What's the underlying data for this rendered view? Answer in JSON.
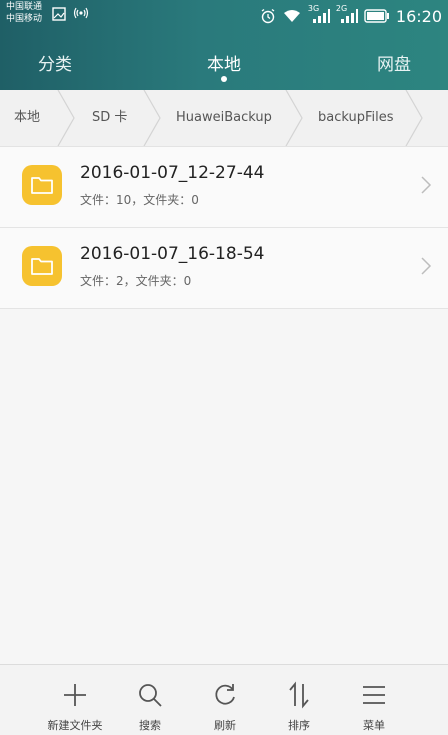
{
  "status_bar": {
    "carrier_1": "中国联通",
    "carrier_2": "中国移动",
    "network_1": "3G",
    "network_2": "2G",
    "time": "16:20"
  },
  "tabs": [
    {
      "label": "分类"
    },
    {
      "label": "本地"
    },
    {
      "label": "网盘"
    }
  ],
  "active_tab": "本地",
  "breadcrumb": [
    "本地",
    "SD 卡",
    "HuaweiBackup",
    "backupFiles"
  ],
  "files": [
    {
      "name": "2016-01-07_12-27-44",
      "meta": "文件：10，文件夹：0"
    },
    {
      "name": "2016-01-07_16-18-54",
      "meta": "文件：2，文件夹：0"
    }
  ],
  "toolbar": [
    {
      "label": "新建文件夹",
      "icon": "plus-icon"
    },
    {
      "label": "搜索",
      "icon": "search-icon"
    },
    {
      "label": "刷新",
      "icon": "refresh-icon"
    },
    {
      "label": "排序",
      "icon": "sort-icon"
    },
    {
      "label": "菜单",
      "icon": "menu-icon"
    }
  ],
  "colors": {
    "header": "#2a7a7c",
    "folder": "#f6c22f"
  }
}
